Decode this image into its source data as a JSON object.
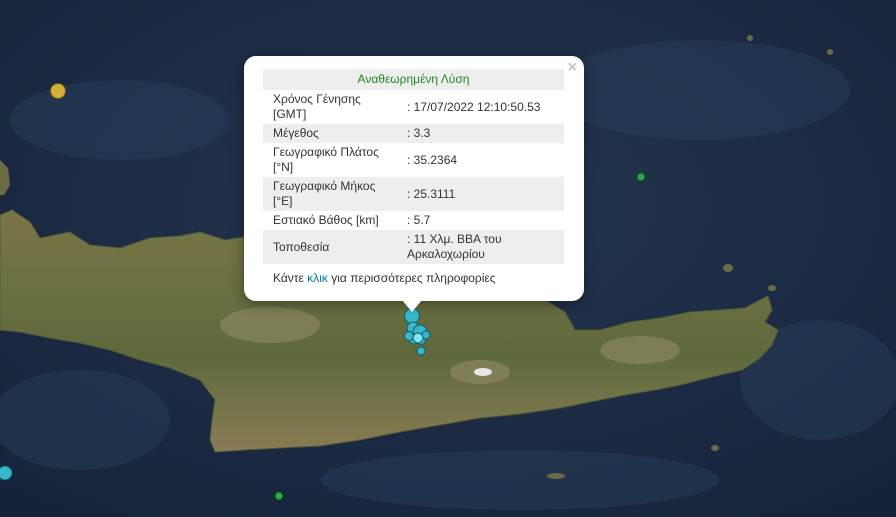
{
  "popup": {
    "title": "Αναθεωρημένη Λύση",
    "close_label": "×",
    "rows": [
      {
        "label": "Χρόνος Γένησης [GMT]",
        "value": ": 17/07/2022 12:10:50.53"
      },
      {
        "label": "Μέγεθος",
        "value": ": 3.3"
      },
      {
        "label": "Γεωγραφικό Πλάτος [°N]",
        "value": ": 35.2364"
      },
      {
        "label": "Γεωγραφικό Μήκος [°E]",
        "value": ": 25.3111"
      },
      {
        "label": "Εστιακό Βάθος [km]",
        "value": ": 5.7"
      },
      {
        "label": "Τοποθεσία",
        "value": ": 11 Χλμ. ΒΒΑ του Αρκαλοχωρίου"
      }
    ],
    "more_prefix": "Κάντε",
    "more_link": "κλικ",
    "more_suffix": "για περισσότερες πληροφορίες"
  },
  "map": {
    "sea_color": "#1e3046",
    "land_color": "#6b6f45",
    "marker_colors": {
      "recent": "#39b7c9",
      "older": "#d4b03a",
      "small": "#2aa84a"
    }
  }
}
